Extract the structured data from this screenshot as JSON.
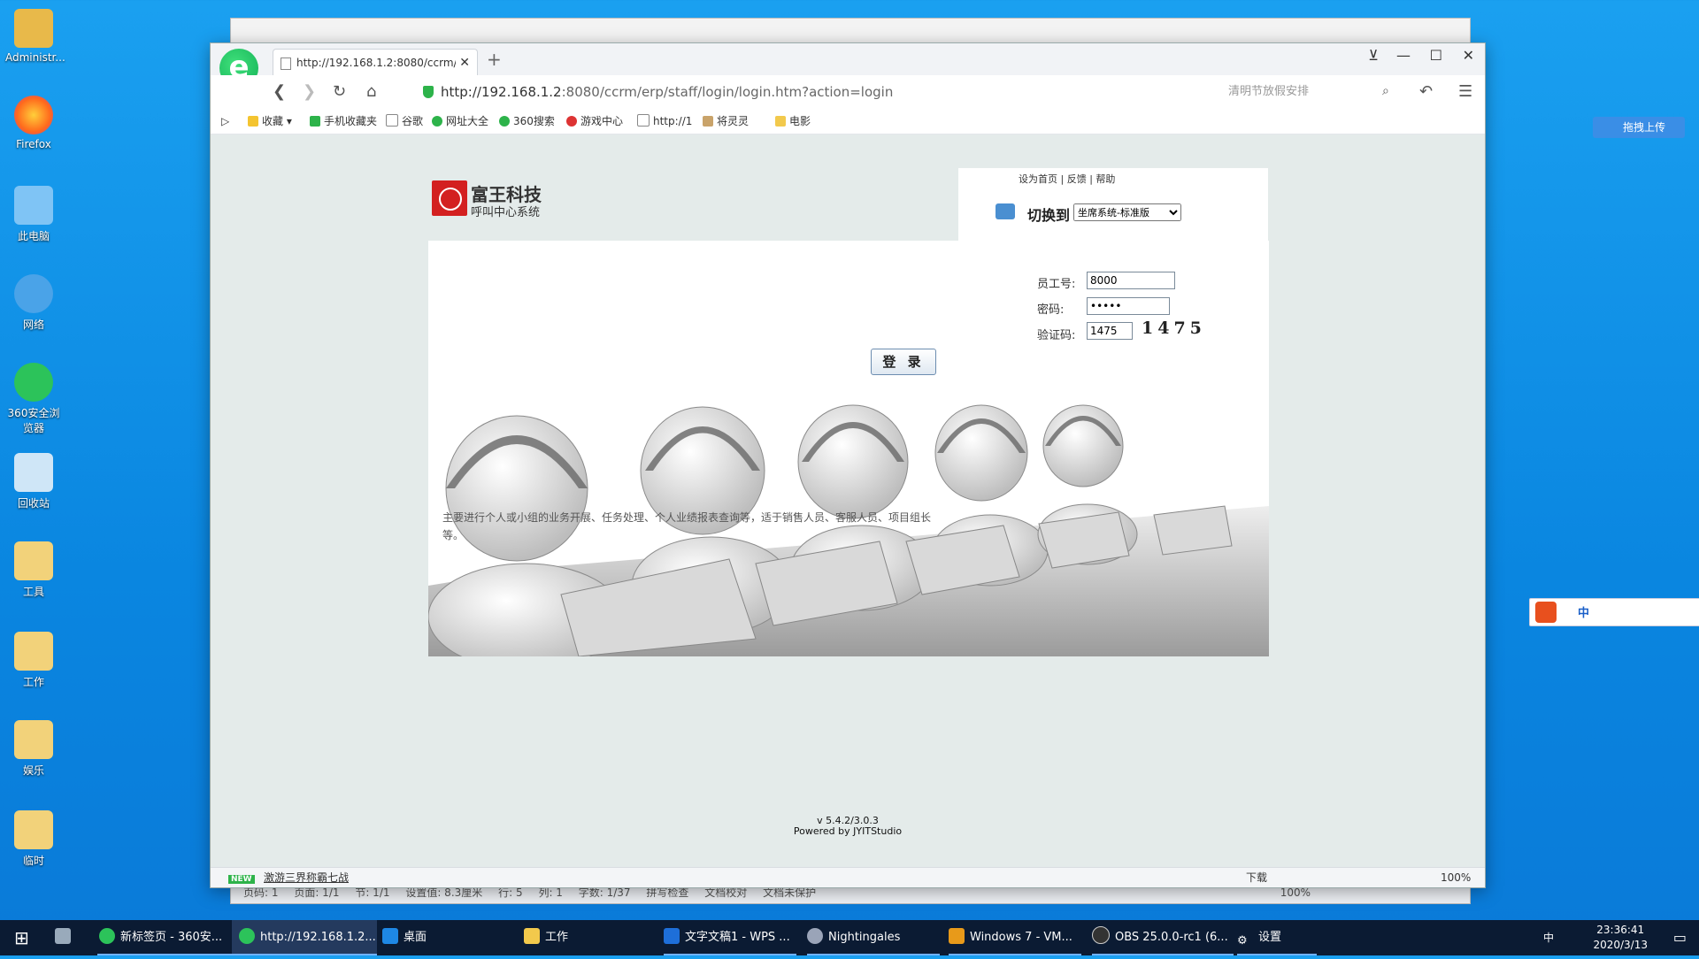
{
  "desktop": {
    "icons": [
      {
        "label": "Administr...",
        "icon": "user-folder-icon",
        "color": "#e8b94a"
      },
      {
        "label": "Firefox",
        "icon": "firefox-icon",
        "color": "#ff7b1c"
      },
      {
        "label": "此电脑",
        "icon": "computer-icon",
        "color": "#7fc4f5"
      },
      {
        "label": "网络",
        "icon": "network-icon",
        "color": "#4aa3e8"
      },
      {
        "label": "360安全浏览器",
        "icon": "browser-360-icon",
        "color": "#2cc35a"
      },
      {
        "label": "回收站",
        "icon": "recycle-bin-icon",
        "color": "#cfe6f7"
      },
      {
        "label": "工具",
        "icon": "folder-icon",
        "color": "#f2d27a"
      },
      {
        "label": "工作",
        "icon": "folder-icon",
        "color": "#f2d27a"
      },
      {
        "label": "娱乐",
        "icon": "folder-icon",
        "color": "#f2d27a"
      },
      {
        "label": "临时",
        "icon": "folder-icon",
        "color": "#f2d27a"
      }
    ]
  },
  "wps_status": {
    "page": "页码: 1",
    "pages": "页面: 1/1",
    "section": "节: 1/1",
    "setting": "设置值: 8.3厘米",
    "row": "行: 5",
    "col": "列: 1",
    "words": "字数: 1/37",
    "spell": "拼写检查",
    "proof": "文档校对",
    "protect": "文档未保护",
    "zoom": "100%"
  },
  "browser": {
    "tab_title": "http://192.168.1.2:8080/ccrm/",
    "url_host": "http://192.168.1.2",
    "url_rest": ":8080/ccrm/erp/staff/login/login.htm?action=login",
    "search_placeholder": "清明节放假安排",
    "bookmarks": [
      "收藏",
      "手机收藏夹",
      "谷歌",
      "网址大全",
      "360搜索",
      "游戏中心",
      "http://1",
      "将灵灵",
      "电影"
    ],
    "status_news": "激游三界称霸七战",
    "status_download": "下载",
    "status_zoom": "100%"
  },
  "login": {
    "brand_name": "富王科技",
    "brand_sub": "呼叫中心系统",
    "links": [
      "设为首页",
      "反馈",
      "帮助"
    ],
    "switch_label": "切换到",
    "system_option": "坐席系统-标准版",
    "employee_label": "员工号:",
    "employee_value": "8000",
    "password_label": "密码:",
    "password_value": "•••••",
    "captcha_label": "验证码:",
    "captcha_input": "1475",
    "captcha_image": "1475",
    "login_button": "登 录",
    "description": "主要进行个人或小组的业务开展、任务处理、个人业绩报表查询等，适于销售人员、客服人员、项目组长等。",
    "version": "v 5.4.2/3.0.3",
    "powered": "Powered by JYITStudio"
  },
  "upload_widget": "拖拽上传",
  "ime_label": "中",
  "taskbar": {
    "items": [
      "新标签页 - 360安...",
      "http://192.168.1.2...",
      "桌面",
      "工作",
      "文字文稿1 - WPS ...",
      "Nightingales",
      "Windows 7 - VM...",
      "OBS 25.0.0-rc1 (6...",
      "设置"
    ],
    "time": "23:36:41",
    "date": "2020/3/13",
    "lang": "中"
  }
}
